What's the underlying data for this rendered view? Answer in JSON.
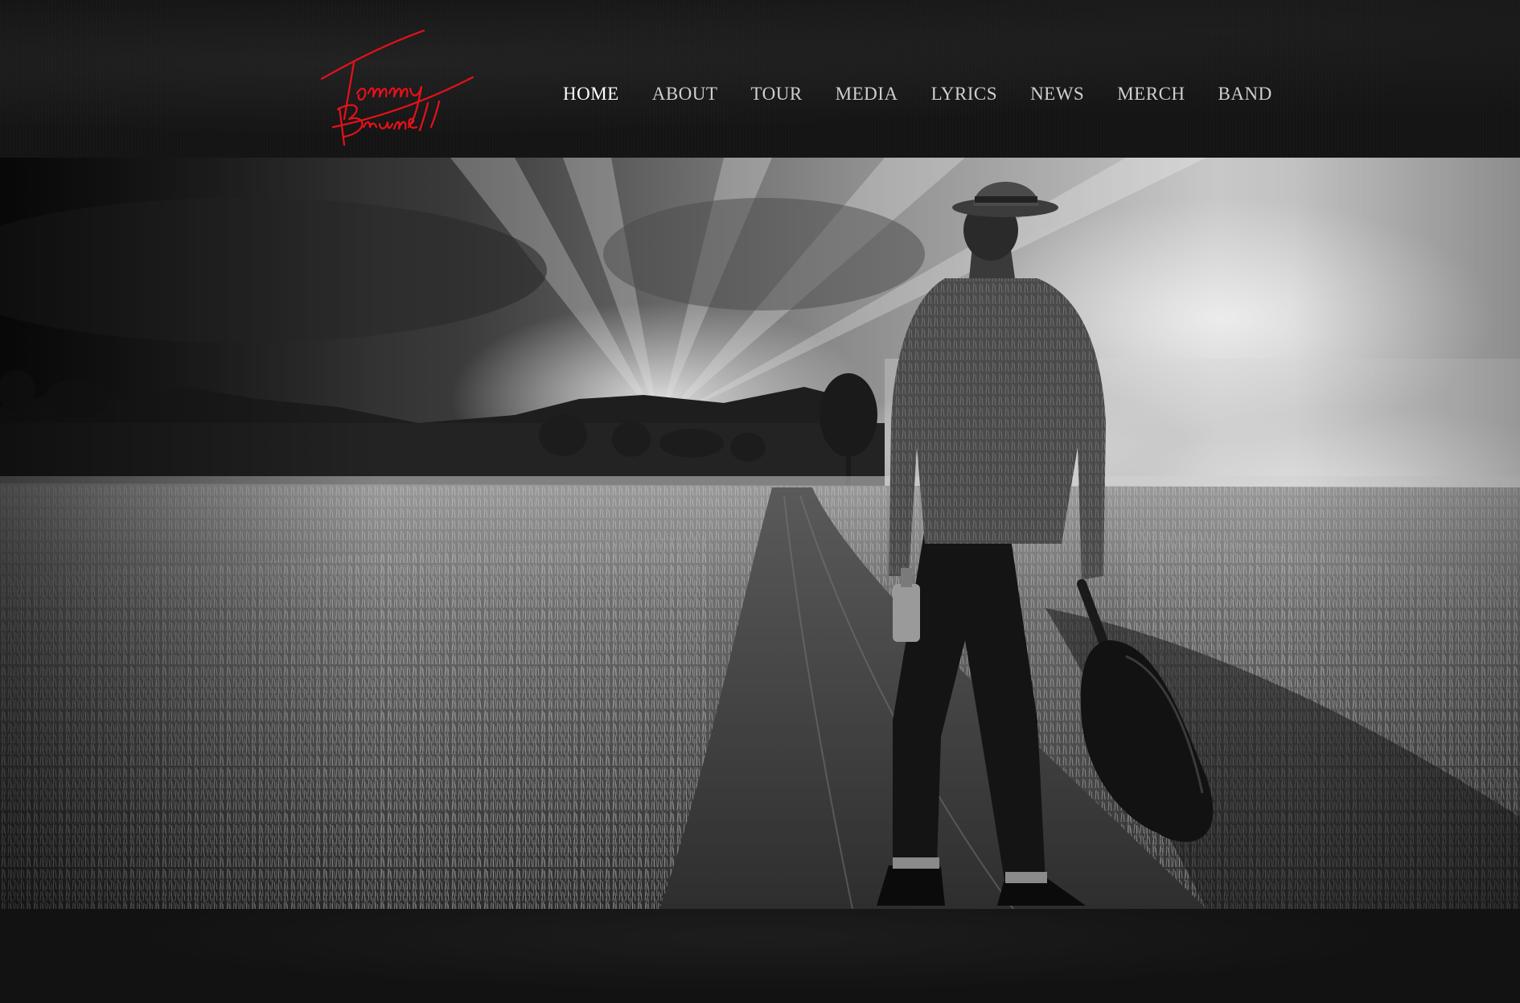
{
  "site": {
    "logo_text": "Tommy Brunett",
    "logo_color": "#e8101a"
  },
  "nav": {
    "items": [
      {
        "label": "HOME",
        "active": true
      },
      {
        "label": "ABOUT",
        "active": false
      },
      {
        "label": "TOUR",
        "active": false
      },
      {
        "label": "MEDIA",
        "active": false
      },
      {
        "label": "LYRICS",
        "active": false
      },
      {
        "label": "NEWS",
        "active": false
      },
      {
        "label": "MERCH",
        "active": false
      },
      {
        "label": "BAND",
        "active": false
      }
    ]
  },
  "hero": {
    "image_icon": "musician-in-field-photo",
    "style": "black-and-white"
  },
  "colors": {
    "header_bg": "#141414",
    "nav_text": "#cfcfcf",
    "nav_active": "#ffffff",
    "page_bg": "#0c0c0c"
  }
}
